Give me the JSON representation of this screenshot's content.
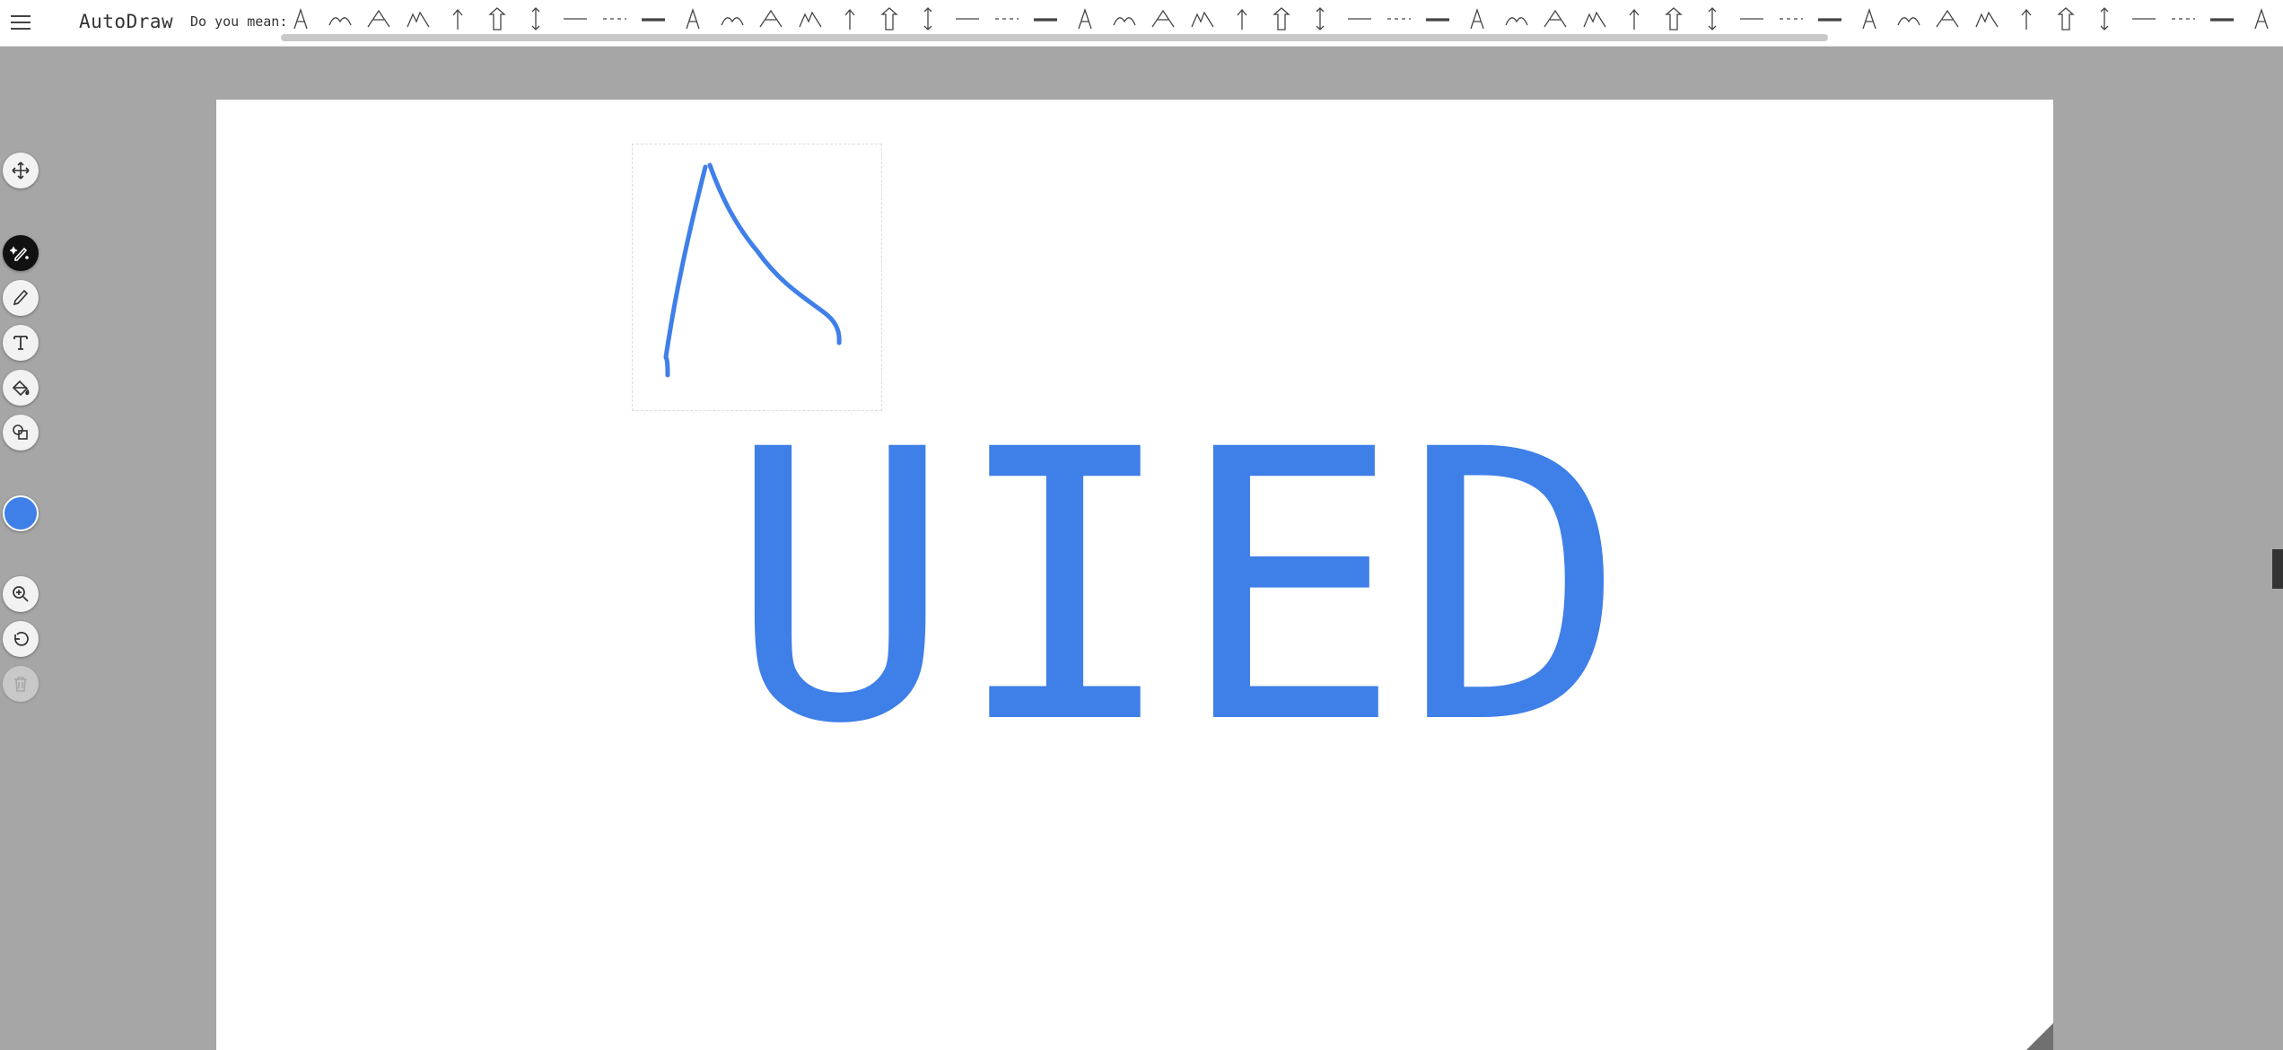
{
  "app": {
    "title": "AutoDraw"
  },
  "suggestions": {
    "label": "Do you mean:",
    "items": [
      "tongs-icon",
      "hill-icon",
      "mountain-icon",
      "mountains-icon",
      "arrow-up-icon",
      "arrow-outline-icon",
      "arrow-double-icon",
      "line-icon",
      "dashed-line-icon",
      "thick-line-icon",
      "lantern-icon",
      "palm-tree-icon",
      "chair-icon",
      "shirt-icon",
      "jacket-icon",
      "coat-icon",
      "cone-icon",
      "ufo-icon",
      "tent-icon",
      "igloo-icon",
      "volcano-icon",
      "island-icon",
      "diamond-icon",
      "pyramid-icon",
      "triangle-icon",
      "solar-panel-icon",
      "pattern-icon",
      "flag-icon",
      "pencil-tool-icon",
      "pencil-icon",
      "pen-icon",
      "high-heel-icon",
      "boot-icon",
      "feet-icon",
      "feather-icon",
      "moon-icon",
      "bird-icon",
      "brush-icon",
      "lamp-icon",
      "paint-brush-icon",
      "ruler-triangle-icon",
      "cone-outline-icon",
      "warning-triangle-icon",
      "buildings-icon",
      "city-icon",
      "plane-icon",
      "document-icon",
      "phone-icon",
      "lounge-chair-icon",
      "eiffel-tower-icon",
      "tower-icon"
    ]
  },
  "toolbar": {
    "tools": [
      {
        "name": "move-tool",
        "icon": "move-icon",
        "active": false
      },
      {
        "name": "autodraw-tool",
        "icon": "autodraw-icon",
        "active": true
      },
      {
        "name": "draw-tool",
        "icon": "pencil-icon",
        "active": false
      },
      {
        "name": "type-tool",
        "icon": "text-icon",
        "active": false
      },
      {
        "name": "fill-tool",
        "icon": "fill-icon",
        "active": false
      },
      {
        "name": "shape-tool",
        "icon": "shapes-icon",
        "active": false
      },
      {
        "name": "zoom-tool",
        "icon": "zoom-icon",
        "active": false
      },
      {
        "name": "undo-tool",
        "icon": "undo-icon",
        "active": false
      },
      {
        "name": "delete-tool",
        "icon": "trash-icon",
        "active": false,
        "disabled": true
      }
    ]
  },
  "color": {
    "current": "#3f7fe8"
  },
  "canvas": {
    "text": "UIED",
    "text_color": "#3f7fe8",
    "stroke_color": "#3f7fe8"
  }
}
